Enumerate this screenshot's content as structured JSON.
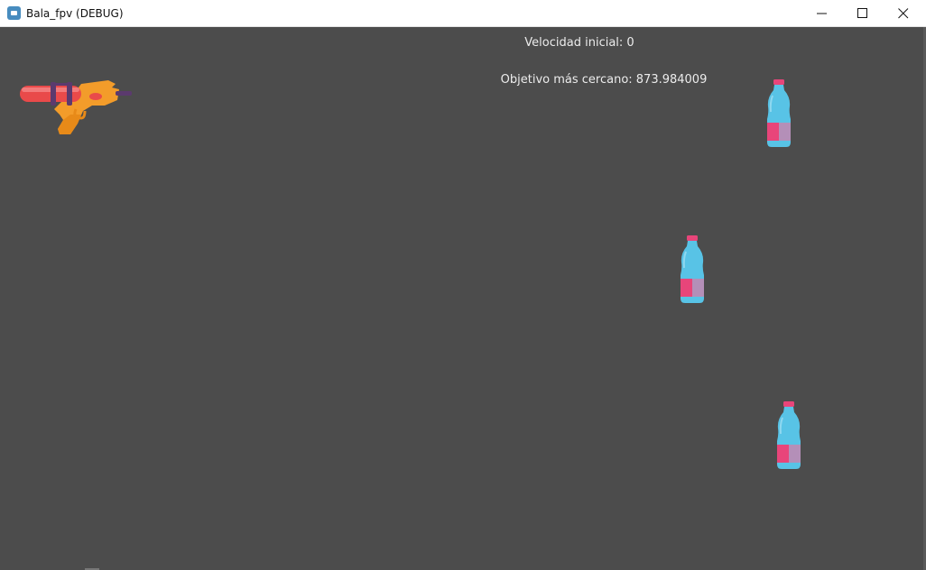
{
  "window": {
    "title": "Bala_fpv (DEBUG)",
    "controls": [
      "minimize",
      "maximize",
      "close"
    ]
  },
  "hud": {
    "speed_text": "Velocidad inicial: 0",
    "nearest_target_text": "Objetivo más cercano: 873.984009"
  },
  "scene": {
    "background_color": "#4c4c4c",
    "player": {
      "sprite": "water-gun",
      "colors": [
        "#e94a4a",
        "#f39c2a",
        "#5b3a6e"
      ]
    },
    "targets": [
      {
        "sprite": "water-bottle"
      },
      {
        "sprite": "water-bottle"
      },
      {
        "sprite": "water-bottle"
      }
    ],
    "bottle_colors": {
      "body": "#58c3e6",
      "label": "#e8457a",
      "cap": "#e8457a"
    }
  }
}
